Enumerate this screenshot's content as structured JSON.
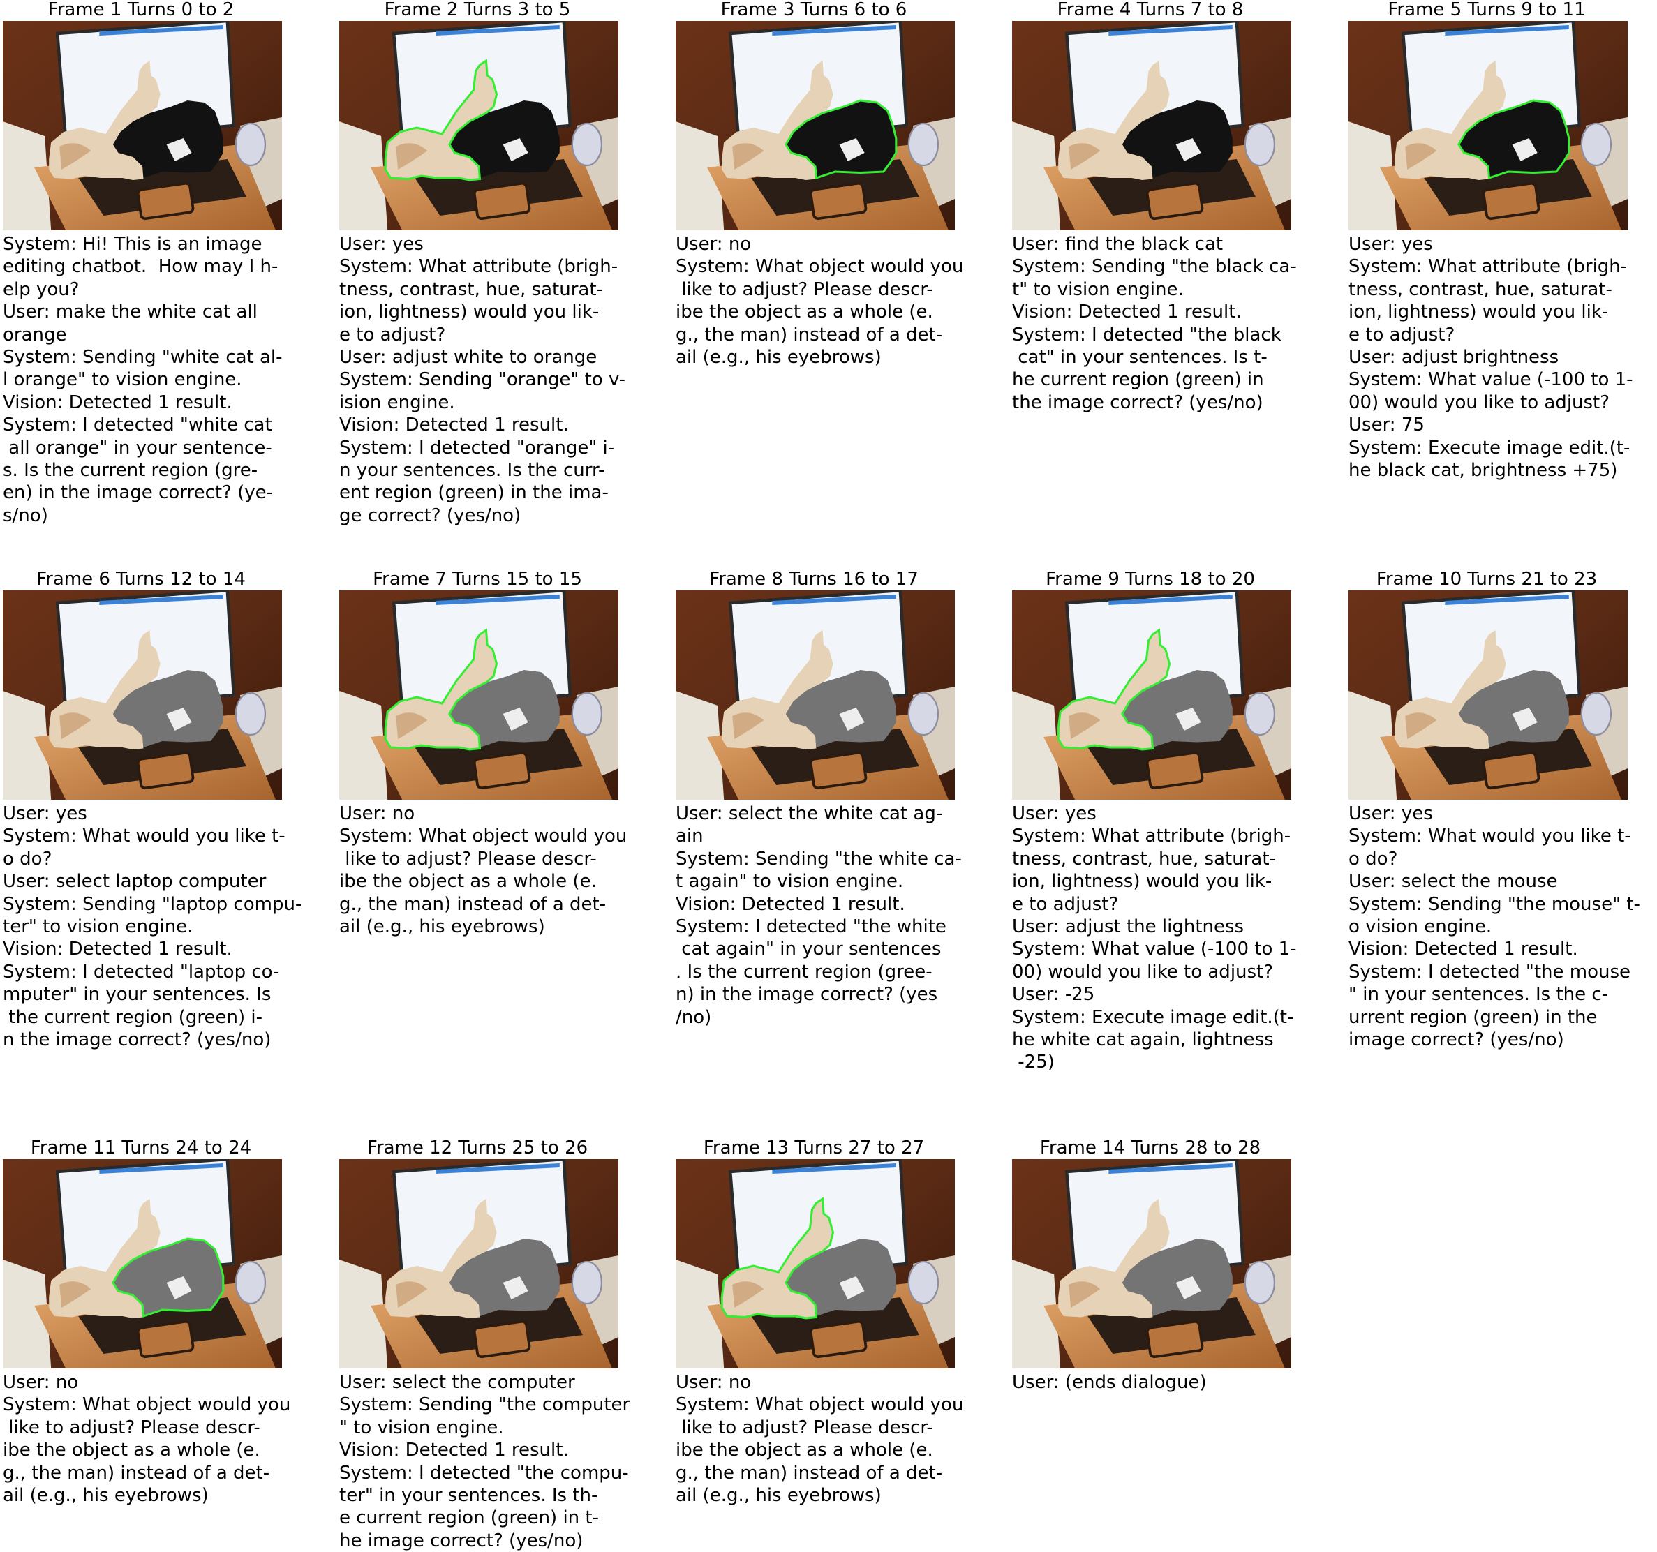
{
  "frames": [
    {
      "title": "Frame 1 Turns 0 to 2",
      "mask": "none",
      "edited": false,
      "text": "System: Hi! This is an image\nediting chatbot.  How may I h-\nelp you?\nUser: make the white cat all\norange\nSystem: Sending \"white cat al-\nl orange\" to vision engine.\nVision: Detected 1 result.\nSystem: I detected \"white cat\n all orange\" in your sentence-\ns. Is the current region (gre-\nen) in the image correct? (ye-\ns/no)"
    },
    {
      "title": "Frame 2 Turns 3 to 5",
      "mask": "white",
      "edited": false,
      "text": "User: yes\nSystem: What attribute (brigh-\ntness, contrast, hue, saturat-\nion, lightness) would you lik-\ne to adjust?\nUser: adjust white to orange\nSystem: Sending \"orange\" to v-\nision engine.\nVision: Detected 1 result.\nSystem: I detected \"orange\" i-\nn your sentences. Is the curr-\nent region (green) in the ima-\nge correct? (yes/no)"
    },
    {
      "title": "Frame 3 Turns 6 to 6",
      "mask": "black",
      "edited": false,
      "text": "User: no\nSystem: What object would you\n like to adjust? Please descr-\nibe the object as a whole (e.\ng., the man) instead of a det-\nail (e.g., his eyebrows)"
    },
    {
      "title": "Frame 4 Turns 7 to 8",
      "mask": "none",
      "edited": false,
      "text": "User: find the black cat\nSystem: Sending \"the black ca-\nt\" to vision engine.\nVision: Detected 1 result.\nSystem: I detected \"the black\n cat\" in your sentences. Is t-\nhe current region (green) in\nthe image correct? (yes/no)"
    },
    {
      "title": "Frame 5 Turns 9 to 11",
      "mask": "black",
      "edited": false,
      "text": "User: yes\nSystem: What attribute (brigh-\ntness, contrast, hue, saturat-\nion, lightness) would you lik-\ne to adjust?\nUser: adjust brightness\nSystem: What value (-100 to 1-\n00) would you like to adjust?\nUser: 75\nSystem: Execute image edit.(t-\nhe black cat, brightness +75)"
    },
    {
      "title": "Frame 6 Turns 12 to 14",
      "mask": "none",
      "edited": true,
      "text": "User: yes\nSystem: What would you like t-\no do?\nUser: select laptop computer\nSystem: Sending \"laptop compu-\nter\" to vision engine.\nVision: Detected 1 result.\nSystem: I detected \"laptop co-\nmputer\" in your sentences. Is\n the current region (green) i-\nn the image correct? (yes/no)"
    },
    {
      "title": "Frame 7 Turns 15 to 15",
      "mask": "white",
      "edited": true,
      "text": "User: no\nSystem: What object would you\n like to adjust? Please descr-\nibe the object as a whole (e.\ng., the man) instead of a det-\nail (e.g., his eyebrows)"
    },
    {
      "title": "Frame 8 Turns 16 to 17",
      "mask": "none",
      "edited": true,
      "text": "User: select the white cat ag-\nain\nSystem: Sending \"the white ca-\nt again\" to vision engine.\nVision: Detected 1 result.\nSystem: I detected \"the white\n cat again\" in your sentences\n. Is the current region (gree-\nn) in the image correct? (yes\n/no)"
    },
    {
      "title": "Frame 9 Turns 18 to 20",
      "mask": "white",
      "edited": true,
      "text": "User: yes\nSystem: What attribute (brigh-\ntness, contrast, hue, saturat-\nion, lightness) would you lik-\ne to adjust?\nUser: adjust the lightness\nSystem: What value (-100 to 1-\n00) would you like to adjust?\nUser: -25\nSystem: Execute image edit.(t-\nhe white cat again, lightness\n -25)"
    },
    {
      "title": "Frame 10 Turns 21 to 23",
      "mask": "none",
      "edited": true,
      "text": "User: yes\nSystem: What would you like t-\no do?\nUser: select the mouse\nSystem: Sending \"the mouse\" t-\no vision engine.\nVision: Detected 1 result.\nSystem: I detected \"the mouse\n\" in your sentences. Is the c-\nurrent region (green) in the\nimage correct? (yes/no)"
    },
    {
      "title": "Frame 11 Turns 24 to 24",
      "mask": "black",
      "edited": true,
      "text": "User: no\nSystem: What object would you\n like to adjust? Please descr-\nibe the object as a whole (e.\ng., the man) instead of a det-\nail (e.g., his eyebrows)"
    },
    {
      "title": "Frame 12 Turns 25 to 26",
      "mask": "none",
      "edited": true,
      "text": "User: select the computer\nSystem: Sending \"the computer\n\" to vision engine.\nVision: Detected 1 result.\nSystem: I detected \"the compu-\nter\" in your sentences. Is th-\ne current region (green) in t-\nhe image correct? (yes/no)"
    },
    {
      "title": "Frame 13 Turns 27 to 27",
      "mask": "white",
      "edited": true,
      "text": "User: no\nSystem: What object would you\n like to adjust? Please descr-\nibe the object as a whole (e.\ng., the man) instead of a det-\nail (e.g., his eyebrows)"
    },
    {
      "title": "Frame 14 Turns 28 to 28",
      "mask": "none",
      "edited": true,
      "text": "User: (ends dialogue)"
    }
  ],
  "colors": {
    "mask_outline": "#33ee33",
    "background": "#ffffff",
    "table": "#5a2a14",
    "screen": "#f2f5fa",
    "screen_bar": "#3b82d6",
    "white_cat": "#e6d2b6",
    "white_cat_shade": "#c89a6e",
    "black_cat": "#121212",
    "black_cat_edited": "#747474",
    "keyboard": "#2a1e16",
    "laptop_base": "#c7844a",
    "mouse": "#d6d8e6"
  }
}
